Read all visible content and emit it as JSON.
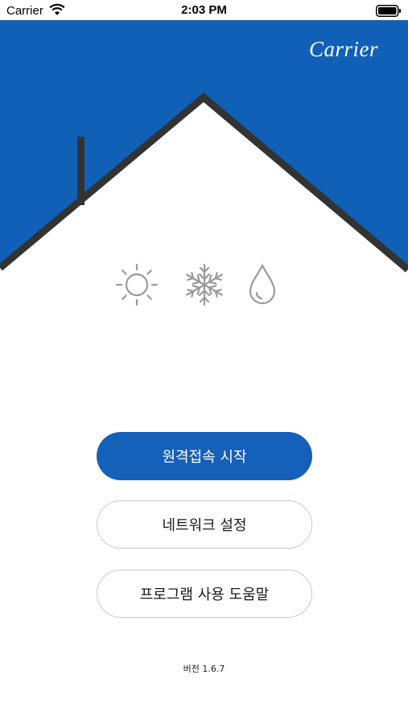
{
  "status_bar": {
    "carrier": "Carrier",
    "time": "2:03 PM",
    "wifi_icon": "wifi-icon",
    "battery_icon": "battery-icon"
  },
  "header": {
    "brand": "Carrier",
    "background_color": "#1160b7",
    "roof_color": "#333333"
  },
  "mode_icons": [
    "sun-icon",
    "snowflake-icon",
    "droplet-icon"
  ],
  "buttons": {
    "remote_start": "원격접속 시작",
    "network_settings": "네트워크 설정",
    "program_help": "프로그램 사용 도움말"
  },
  "footer": {
    "version": "버전 1.6.7"
  },
  "colors": {
    "primary": "#1560b8",
    "outline": "#c9c9c9",
    "icon_gray": "#9a9a9a"
  }
}
